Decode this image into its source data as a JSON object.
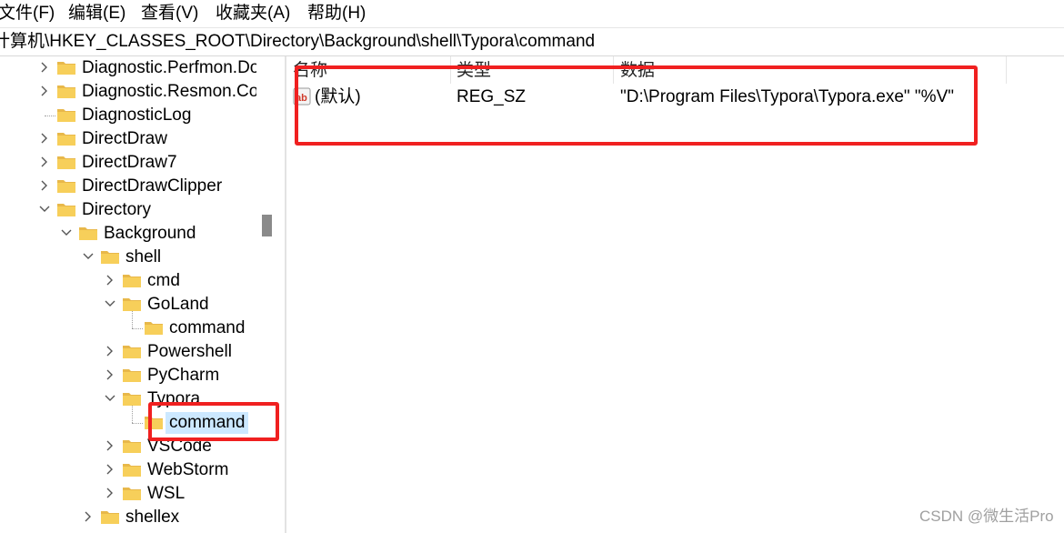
{
  "menu": [
    {
      "label": "文件(F)"
    },
    {
      "label": "编辑(E)"
    },
    {
      "label": "查看(V)"
    },
    {
      "label": "收藏夹(A)"
    },
    {
      "label": "帮助(H)"
    }
  ],
  "address": "计算机\\HKEY_CLASSES_ROOT\\Directory\\Background\\shell\\Typora\\command",
  "tree": [
    {
      "label": "Diagnostic.Perfmon.Do",
      "expander": "collapsed"
    },
    {
      "label": "Diagnostic.Resmon.Co",
      "expander": "collapsed"
    },
    {
      "label": "DiagnosticLog",
      "expander": "none"
    },
    {
      "label": "DirectDraw",
      "expander": "collapsed"
    },
    {
      "label": "DirectDraw7",
      "expander": "collapsed"
    },
    {
      "label": "DirectDrawClipper",
      "expander": "collapsed"
    },
    {
      "label": "Directory",
      "expander": "expanded"
    },
    {
      "label": "Background",
      "expander": "expanded"
    },
    {
      "label": "shell",
      "expander": "expanded"
    },
    {
      "label": "cmd",
      "expander": "collapsed"
    },
    {
      "label": "GoLand",
      "expander": "expanded"
    },
    {
      "label": "command",
      "expander": "none"
    },
    {
      "label": "Powershell",
      "expander": "collapsed"
    },
    {
      "label": "PyCharm",
      "expander": "collapsed"
    },
    {
      "label": "Typora",
      "expander": "expanded"
    },
    {
      "label": "command",
      "expander": "none",
      "selected": true
    },
    {
      "label": "VSCode",
      "expander": "collapsed"
    },
    {
      "label": "WebStorm",
      "expander": "collapsed"
    },
    {
      "label": "WSL",
      "expander": "collapsed"
    },
    {
      "label": "shellex",
      "expander": "collapsed"
    }
  ],
  "list": {
    "columns": [
      "名称",
      "类型",
      "数据"
    ],
    "rows": [
      {
        "name": "(默认)",
        "type": "REG_SZ",
        "data": "\"D:\\Program Files\\Typora\\Typora.exe\" \"%V\""
      }
    ]
  },
  "colors": {
    "highlight_box": "#f02020",
    "selection": "#cce8ff",
    "folder": "#f7c948"
  },
  "watermark": "CSDN @微生活Pro"
}
